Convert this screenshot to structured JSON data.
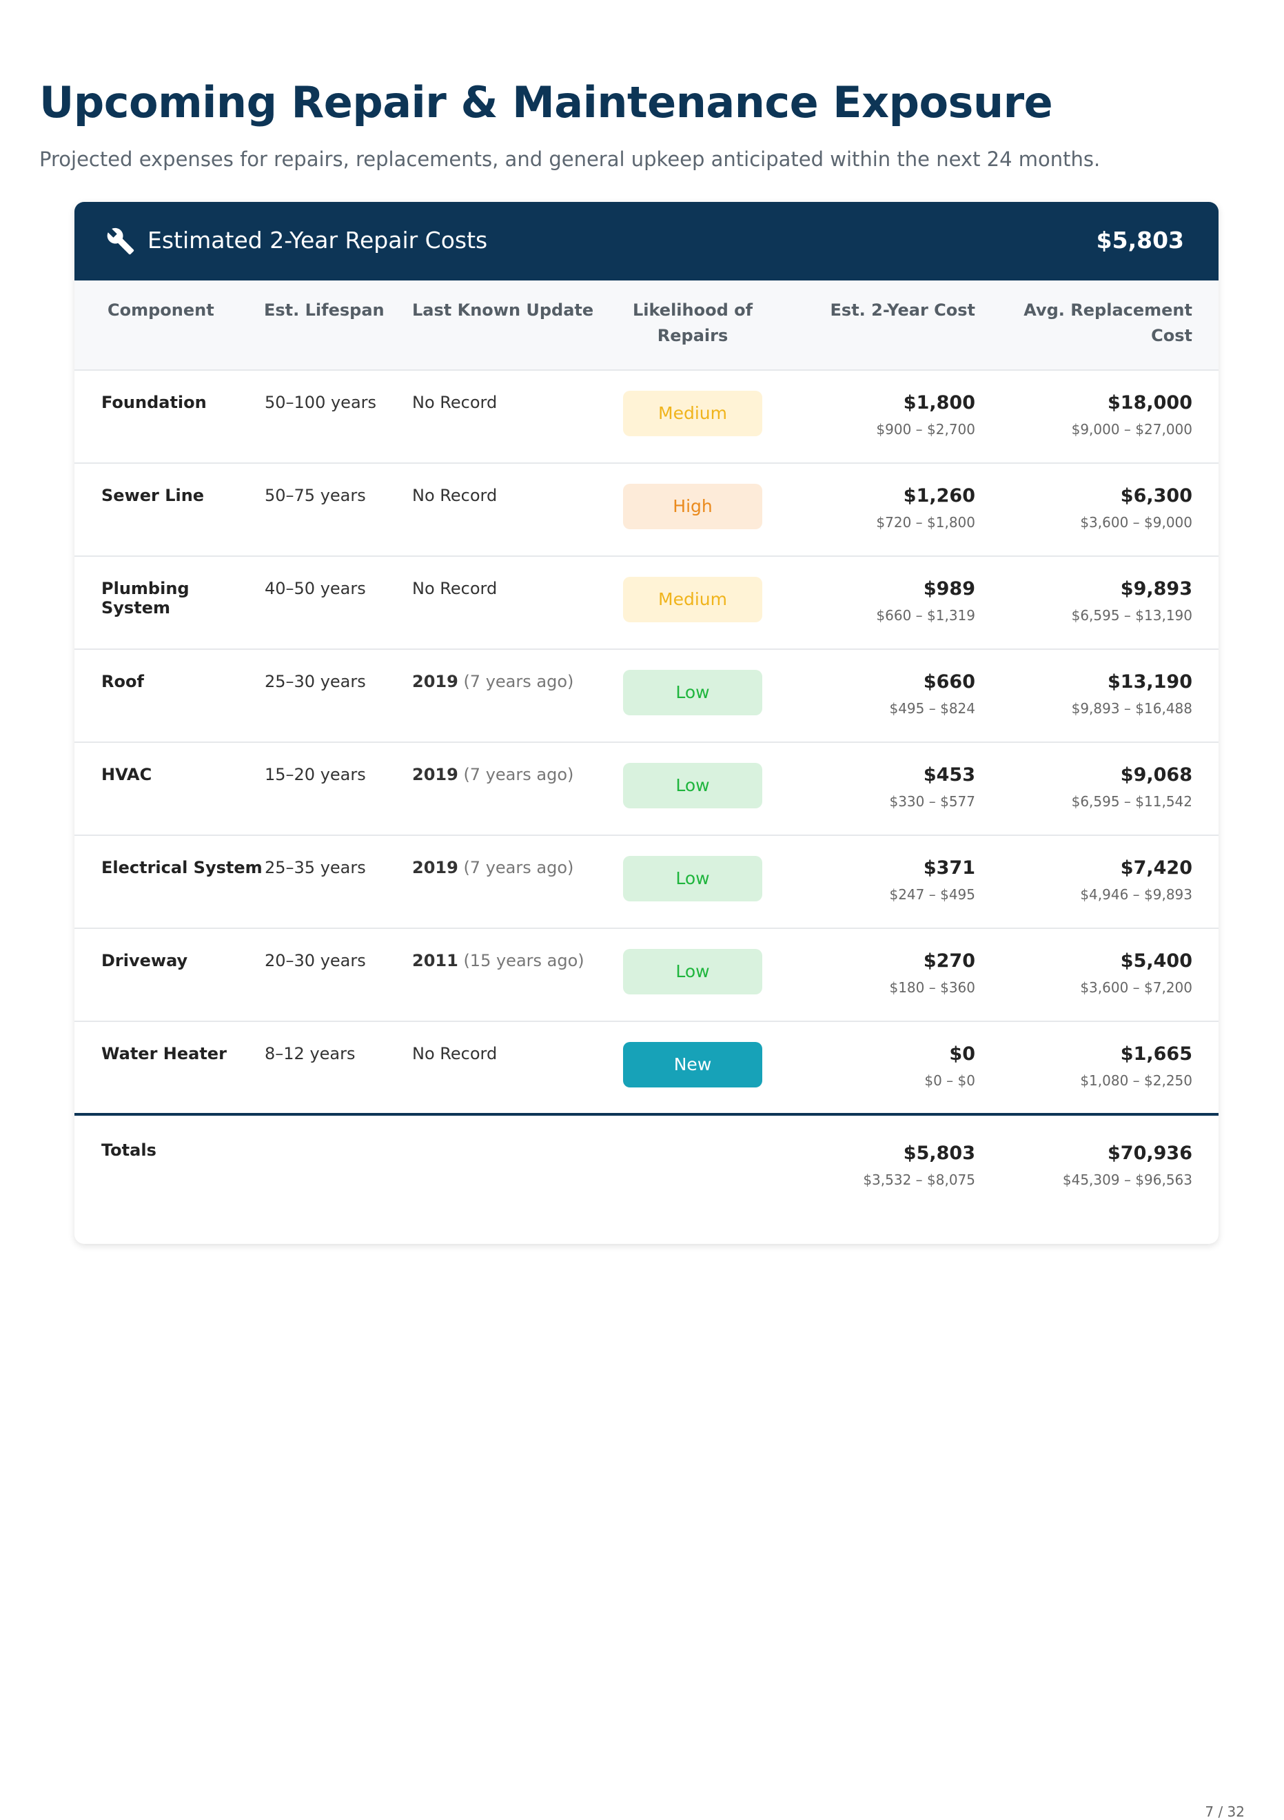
{
  "page": {
    "title": "Upcoming Repair & Maintenance Exposure",
    "subtitle": "Projected expenses for repairs, replacements, and general upkeep anticipated within the next 24 months.",
    "page_number": "7 / 32"
  },
  "card": {
    "icon": "wrench-icon",
    "title": "Estimated 2-Year Repair Costs",
    "total": "$5,803"
  },
  "table": {
    "headers": [
      "Component",
      "Est. Lifespan",
      "Last Known Update",
      "Likelihood of Repairs",
      "Est. 2-Year Cost",
      "Avg. Replacement Cost"
    ],
    "rows": [
      {
        "component": "Foundation",
        "lifespan": "50–100 years",
        "last_year": "No Record",
        "last_ago": "",
        "likelihood": "Medium",
        "badge": {
          "bg": "#fff3d6",
          "fg": "#f0b41c"
        },
        "est_cost": "$1,800",
        "est_range": "$900 – $2,700",
        "avg_cost": "$18,000",
        "avg_range": "$9,000 – $27,000"
      },
      {
        "component": "Sewer Line",
        "lifespan": "50–75 years",
        "last_year": "No Record",
        "last_ago": "",
        "likelihood": "High",
        "badge": {
          "bg": "#fdebd9",
          "fg": "#ea8a1d"
        },
        "est_cost": "$1,260",
        "est_range": "$720 – $1,800",
        "avg_cost": "$6,300",
        "avg_range": "$3,600 – $9,000"
      },
      {
        "component": "Plumbing System",
        "lifespan": "40–50 years",
        "last_year": "No Record",
        "last_ago": "",
        "likelihood": "Medium",
        "badge": {
          "bg": "#fff3d6",
          "fg": "#f0b41c"
        },
        "est_cost": "$989",
        "est_range": "$660 – $1,319",
        "avg_cost": "$9,893",
        "avg_range": "$6,595 – $13,190"
      },
      {
        "component": "Roof",
        "lifespan": "25–30 years",
        "last_year": "2019",
        "last_ago": "(7 years ago)",
        "likelihood": "Low",
        "badge": {
          "bg": "#d9f2de",
          "fg": "#1fb53d"
        },
        "est_cost": "$660",
        "est_range": "$495 – $824",
        "avg_cost": "$13,190",
        "avg_range": "$9,893 – $16,488"
      },
      {
        "component": "HVAC",
        "lifespan": "15–20 years",
        "last_year": "2019",
        "last_ago": "(7 years ago)",
        "likelihood": "Low",
        "badge": {
          "bg": "#d9f2de",
          "fg": "#1fb53d"
        },
        "est_cost": "$453",
        "est_range": "$330 – $577",
        "avg_cost": "$9,068",
        "avg_range": "$6,595 – $11,542"
      },
      {
        "component": "Electrical System",
        "lifespan": "25–35 years",
        "last_year": "2019",
        "last_ago": "(7 years ago)",
        "likelihood": "Low",
        "badge": {
          "bg": "#d9f2de",
          "fg": "#1fb53d"
        },
        "est_cost": "$371",
        "est_range": "$247 – $495",
        "avg_cost": "$7,420",
        "avg_range": "$4,946 – $9,893"
      },
      {
        "component": "Driveway",
        "lifespan": "20–30 years",
        "last_year": "2011",
        "last_ago": "(15 years ago)",
        "likelihood": "Low",
        "badge": {
          "bg": "#d9f2de",
          "fg": "#1fb53d"
        },
        "est_cost": "$270",
        "est_range": "$180 – $360",
        "avg_cost": "$5,400",
        "avg_range": "$3,600 – $7,200"
      },
      {
        "component": "Water Heater",
        "lifespan": "8–12 years",
        "last_year": "No Record",
        "last_ago": "",
        "likelihood": "New",
        "badge": {
          "bg": "#17a2b8",
          "fg": "#ffffff"
        },
        "est_cost": "$0",
        "est_range": "$0 – $0",
        "avg_cost": "$1,665",
        "avg_range": "$1,080 – $2,250"
      }
    ],
    "totals": {
      "label": "Totals",
      "est_cost": "$5,803",
      "est_range": "$3,532 – $8,075",
      "avg_cost": "$70,936",
      "avg_range": "$45,309 – $96,563"
    }
  },
  "colors": {
    "navy": "#0d3556",
    "subtitle_gray": "#5c6670"
  }
}
